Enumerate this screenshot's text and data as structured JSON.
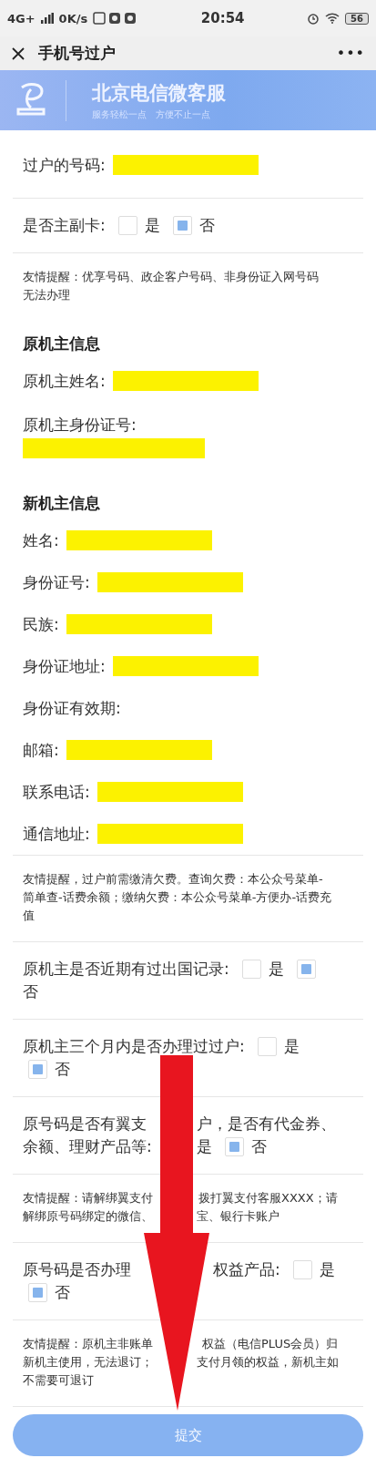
{
  "status_bar": {
    "network": "4G+",
    "speed": "0K/s",
    "time": "20:54",
    "battery": "56"
  },
  "nav": {
    "title": "手机号过户",
    "more": "•••"
  },
  "banner": {
    "title": "北京电信微客服",
    "subtitle": "服务轻松一点　方便不止一点"
  },
  "blocks": [
    {
      "kind": "field",
      "label": "过户的号码:",
      "redacted": true,
      "divider": true
    },
    {
      "kind": "choice",
      "divider": true,
      "lines": [
        [
          {
            "kind": "text",
            "text": "是否主副卡:"
          },
          {
            "kind": "box",
            "checked": false
          },
          {
            "kind": "text",
            "text": "是"
          },
          {
            "kind": "box",
            "checked": true
          },
          {
            "kind": "text",
            "text": "否"
          }
        ]
      ]
    },
    {
      "kind": "tip",
      "divider": false,
      "lines": [
        [
          {
            "kind": "text",
            "text": "友情提醒：优享号码、政企客户号码、非身份证入网号码"
          }
        ],
        [
          {
            "kind": "text",
            "text": "无法办理"
          }
        ]
      ]
    },
    {
      "kind": "heading",
      "text": "原机主信息"
    },
    {
      "kind": "field",
      "label": "原机主姓名:",
      "redacted": true,
      "divider": false
    },
    {
      "kind": "stacked_field",
      "label": "原机主身份证号:",
      "redacted": true,
      "divider": false
    },
    {
      "kind": "heading",
      "text": "新机主信息"
    },
    {
      "kind": "field",
      "label": "姓名:",
      "redacted": true,
      "divider": false
    },
    {
      "kind": "field",
      "label": "身份证号:",
      "redacted": true,
      "divider": false
    },
    {
      "kind": "field",
      "label": "民族:",
      "redacted": true,
      "divider": false
    },
    {
      "kind": "field",
      "label": "身份证地址:",
      "redacted": true,
      "divider": false
    },
    {
      "kind": "field",
      "label": "身份证有效期:",
      "redacted": false,
      "divider": false
    },
    {
      "kind": "field",
      "label": "邮箱:",
      "redacted": true,
      "divider": false
    },
    {
      "kind": "field",
      "label": "联系电话:",
      "redacted": true,
      "divider": false
    },
    {
      "kind": "field",
      "label": "通信地址:",
      "redacted": true,
      "divider": true
    },
    {
      "kind": "tip",
      "divider": true,
      "lines": [
        [
          {
            "kind": "text",
            "text": "友情提醒，过户前需缴清欠费。查询欠费：本公众号菜单-"
          }
        ],
        [
          {
            "kind": "text",
            "text": "简单查-话费余额；缴纳欠费：本公众号菜单-方便办-话费充"
          }
        ],
        [
          {
            "kind": "text",
            "text": "值"
          }
        ]
      ]
    },
    {
      "kind": "choice",
      "divider": true,
      "lines": [
        [
          {
            "kind": "text",
            "text": "原机主是否近期有过出国记录:"
          },
          {
            "kind": "box",
            "checked": false
          },
          {
            "kind": "text",
            "text": "是"
          },
          {
            "kind": "box",
            "checked": true
          }
        ],
        [
          {
            "kind": "text",
            "text": "否"
          }
        ]
      ]
    },
    {
      "kind": "choice",
      "divider": true,
      "lines": [
        [
          {
            "kind": "text",
            "text": "原机主三个月内是否办理过过户:"
          },
          {
            "kind": "box",
            "checked": false
          },
          {
            "kind": "text",
            "text": "是"
          }
        ],
        [
          {
            "kind": "box",
            "checked": true
          },
          {
            "kind": "text",
            "text": "否"
          }
        ]
      ]
    },
    {
      "kind": "choice",
      "divider": true,
      "lines": [
        [
          {
            "kind": "text",
            "text": "原号码是否有翼支"
          },
          {
            "kind": "gap"
          },
          {
            "kind": "text",
            "text": "户，是否有代金券、"
          }
        ],
        [
          {
            "kind": "text",
            "text": "余额、理财产品等:"
          },
          {
            "kind": "gap"
          },
          {
            "kind": "text",
            "text": "是"
          },
          {
            "kind": "box",
            "checked": true
          },
          {
            "kind": "text",
            "text": "否"
          }
        ]
      ]
    },
    {
      "kind": "tip",
      "divider": true,
      "lines": [
        [
          {
            "kind": "text",
            "text": "友情提醒：请解绑翼支付"
          },
          {
            "kind": "gap"
          },
          {
            "kind": "text",
            "text": "拨打翼支付客服XXXX；请"
          }
        ],
        [
          {
            "kind": "text",
            "text": "解绑原号码绑定的微信、"
          },
          {
            "kind": "gap"
          },
          {
            "kind": "text",
            "text": "宝、银行卡账户"
          }
        ]
      ]
    },
    {
      "kind": "choice",
      "divider": true,
      "lines": [
        [
          {
            "kind": "text",
            "text": "原号码是否办理"
          },
          {
            "kind": "gap"
          },
          {
            "kind": "text",
            "text": "权益产品:"
          },
          {
            "kind": "box",
            "checked": false
          },
          {
            "kind": "text",
            "text": "是"
          }
        ],
        [
          {
            "kind": "box",
            "checked": true
          },
          {
            "kind": "text",
            "text": "否"
          }
        ]
      ]
    },
    {
      "kind": "tip",
      "divider": true,
      "lines": [
        [
          {
            "kind": "text",
            "text": "友情提醒：原机主非账单"
          },
          {
            "kind": "gap"
          },
          {
            "kind": "text",
            "text": "权益（电信PLUS会员）归"
          }
        ],
        [
          {
            "kind": "text",
            "text": "新机主使用，无法退订；"
          },
          {
            "kind": "gap"
          },
          {
            "kind": "text",
            "text": "支付月领的权益，新机主如"
          }
        ],
        [
          {
            "kind": "text",
            "text": "不需要可退订"
          }
        ]
      ]
    }
  ],
  "submit": {
    "label": "提交"
  }
}
